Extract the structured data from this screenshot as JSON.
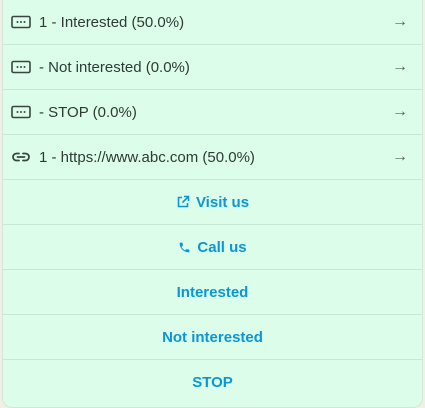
{
  "stats": [
    {
      "icon": "message-icon",
      "text": "1 - Interested (50.0%)"
    },
    {
      "icon": "message-icon",
      "text": " - Not interested (0.0%)"
    },
    {
      "icon": "message-icon",
      "text": " - STOP (0.0%)"
    },
    {
      "icon": "link-icon",
      "text": "1 - https://www.abc.com (50.0%)"
    }
  ],
  "arrow_glyph": "→",
  "actions": {
    "visit_us": "Visit us",
    "call_us": "Call us",
    "interested": "Interested",
    "not_interested": "Not interested",
    "stop": "STOP"
  },
  "colors": {
    "background": "#dcfde9",
    "accent": "#0b96d6",
    "divider": "#c7e8d3",
    "text": "#2e3a35"
  }
}
